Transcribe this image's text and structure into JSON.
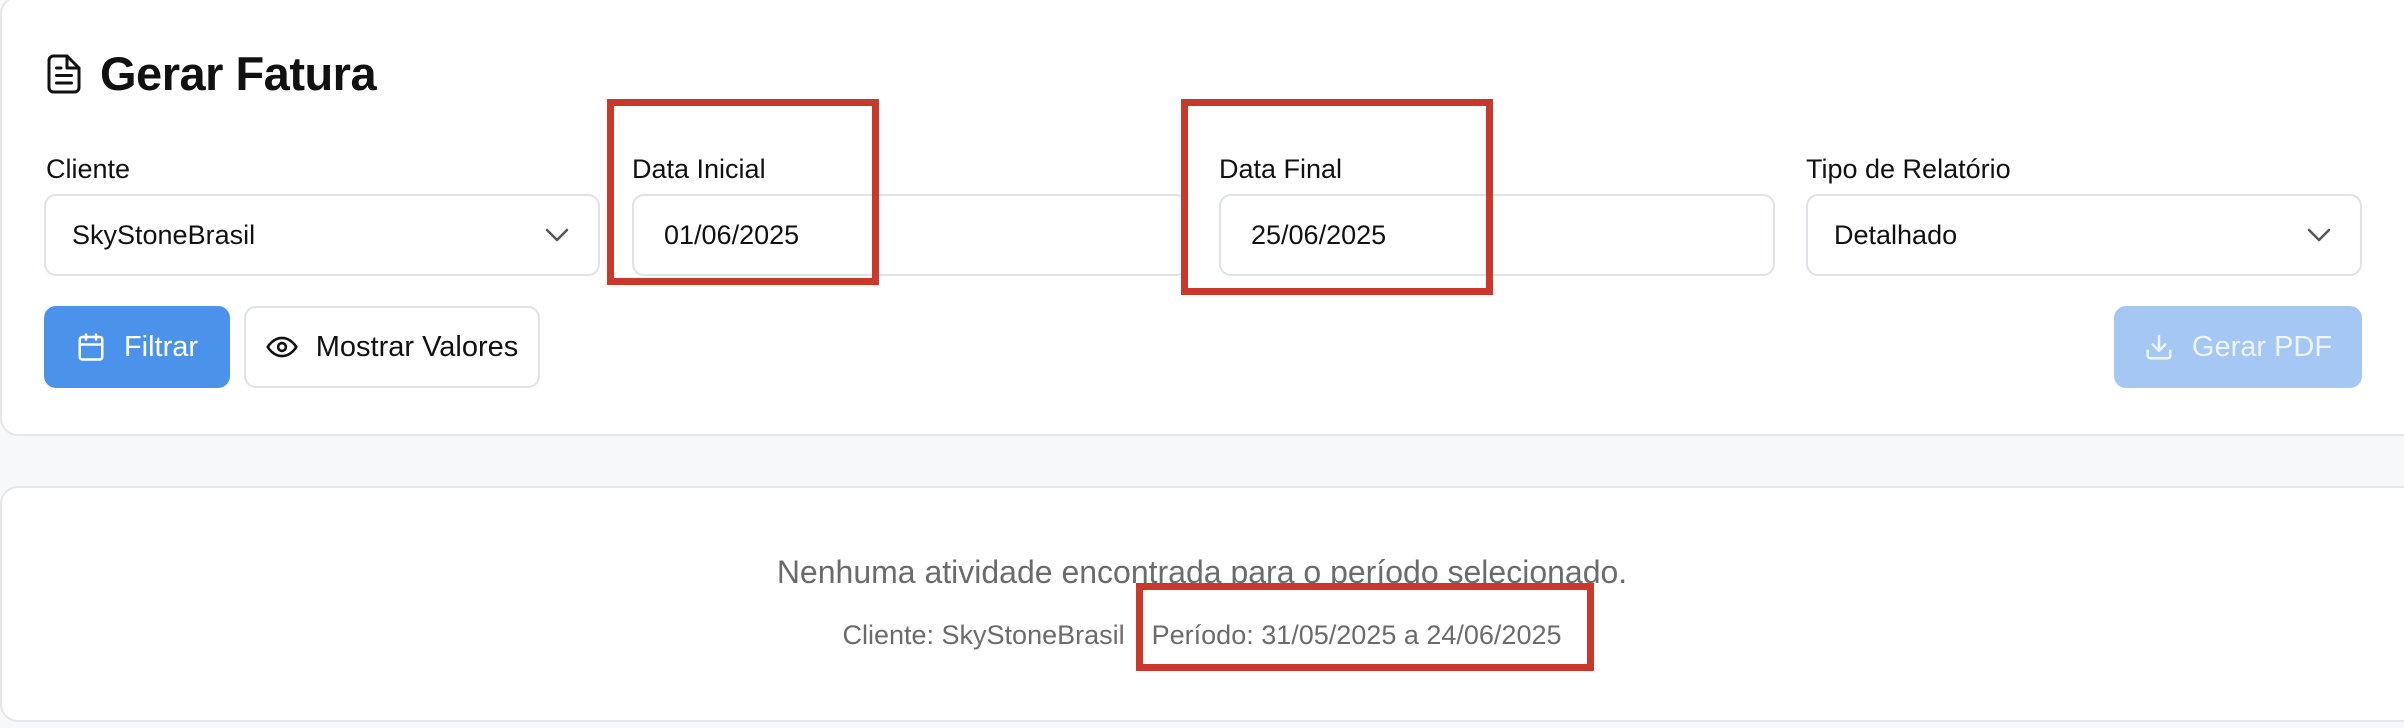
{
  "header": {
    "title": "Gerar Fatura",
    "icon": "document-icon"
  },
  "fields": {
    "cliente": {
      "label": "Cliente",
      "value": "SkyStoneBrasil"
    },
    "data_inicial": {
      "label": "Data Inicial",
      "value": "01/06/2025"
    },
    "data_final": {
      "label": "Data Final",
      "value": "25/06/2025"
    },
    "tipo_relatorio": {
      "label": "Tipo de Relatório",
      "value": "Detalhado"
    }
  },
  "buttons": {
    "filtrar": "Filtrar",
    "mostrar_valores": "Mostrar Valores",
    "gerar_pdf": "Gerar PDF"
  },
  "results": {
    "empty_message": "Nenhuma atividade encontrada para o período selecionado.",
    "cliente_summary": "Cliente: SkyStoneBrasil",
    "separator": "|",
    "periodo_summary": "Período: 31/05/2025 a 24/06/2025"
  },
  "colors": {
    "primary": "#4a92ea",
    "primary_disabled": "#a4c7f4",
    "highlight": "#c9392b",
    "muted_text": "#6b6b6b"
  }
}
